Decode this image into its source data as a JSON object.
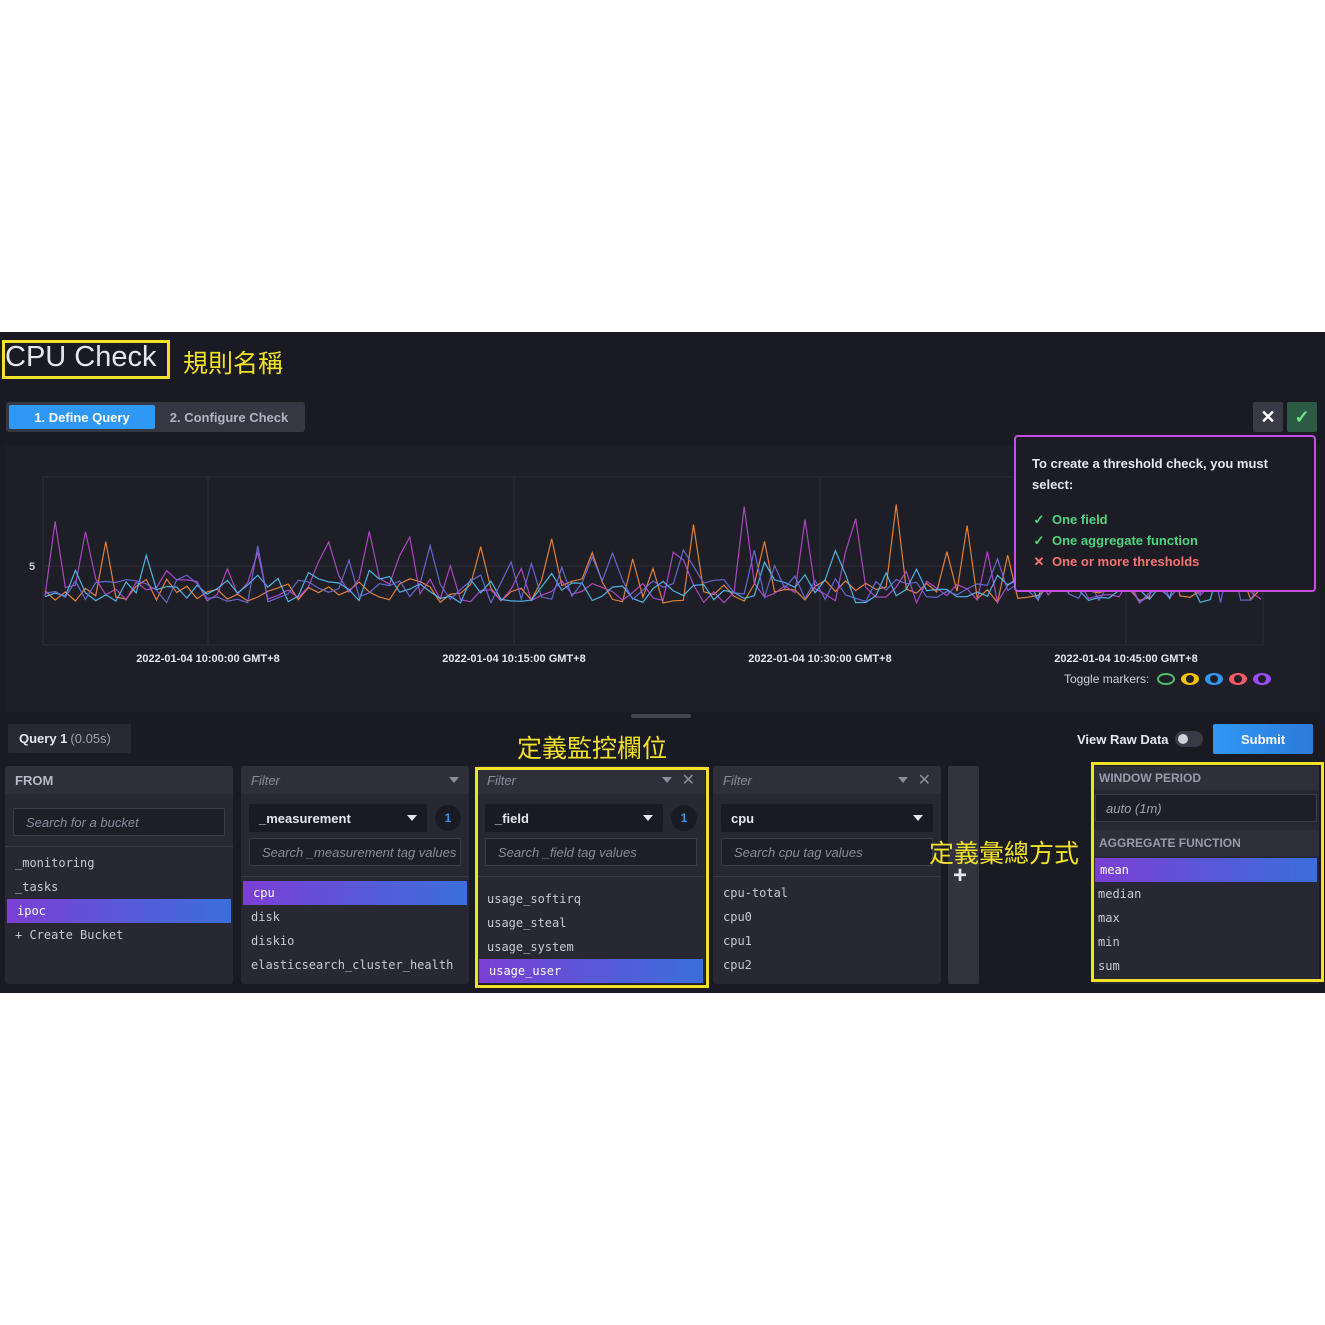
{
  "page": {
    "title": "CPU Check",
    "annotations": {
      "rule_name": "規則名稱",
      "define_field": "定義監控欄位",
      "define_agg": "定義彙總方式"
    }
  },
  "steps": [
    {
      "label": "1. Define Query",
      "active": true
    },
    {
      "label": "2. Configure Check",
      "active": false
    }
  ],
  "header_buttons": {
    "cancel": "✕",
    "confirm": "✓"
  },
  "tooltip": {
    "intro": "To create a threshold check, you must select:",
    "requirements": [
      {
        "label": "One field",
        "met": true
      },
      {
        "label": "One aggregate function",
        "met": true
      },
      {
        "label": "One or more thresholds",
        "met": false
      }
    ]
  },
  "graph": {
    "y_tick": "5",
    "x_ticks": [
      "2022-01-04 10:00:00 GMT+8",
      "2022-01-04 10:15:00 GMT+8",
      "2022-01-04 10:30:00 GMT+8",
      "2022-01-04 10:45:00 GMT+8"
    ],
    "toggle_label": "Toggle markers:",
    "marker_colors": [
      "#4ec06a",
      "#f5c200",
      "#2f97f6",
      "#f45b69",
      "#9b4dfc"
    ],
    "series_colors": [
      "#f48c3a",
      "#b94bd0",
      "#4fc3f7",
      "#6b6fe0"
    ]
  },
  "query": {
    "tab_label": "Query 1",
    "tab_time": "(0.05s)",
    "view_raw": "View Raw Data",
    "submit": "Submit"
  },
  "from": {
    "header": "FROM",
    "search_placeholder": "Search for a bucket",
    "buckets": [
      "_monitoring",
      "_tasks",
      "ipoc",
      "+ Create Bucket"
    ],
    "selected": "ipoc"
  },
  "filter1": {
    "header": "Filter",
    "key": "_measurement",
    "count": "1",
    "search_placeholder": "Search _measurement tag values",
    "values": [
      "cpu",
      "disk",
      "diskio",
      "elasticsearch_cluster_health"
    ],
    "selected": "cpu"
  },
  "filter2": {
    "header": "Filter",
    "key": "_field",
    "count": "1",
    "search_placeholder": "Search _field tag values",
    "values": [
      "usage_softirq",
      "usage_steal",
      "usage_system",
      "usage_user"
    ],
    "selected": "usage_user"
  },
  "filter3": {
    "header": "Filter",
    "key": "cpu",
    "search_placeholder": "Search cpu tag values",
    "values": [
      "cpu-total",
      "cpu0",
      "cpu1",
      "cpu2"
    ]
  },
  "aggregate": {
    "window_header": "WINDOW PERIOD",
    "window_value": "auto (1m)",
    "function_header": "AGGREGATE FUNCTION",
    "functions": [
      "mean",
      "median",
      "max",
      "min",
      "sum"
    ],
    "selected": "mean"
  }
}
